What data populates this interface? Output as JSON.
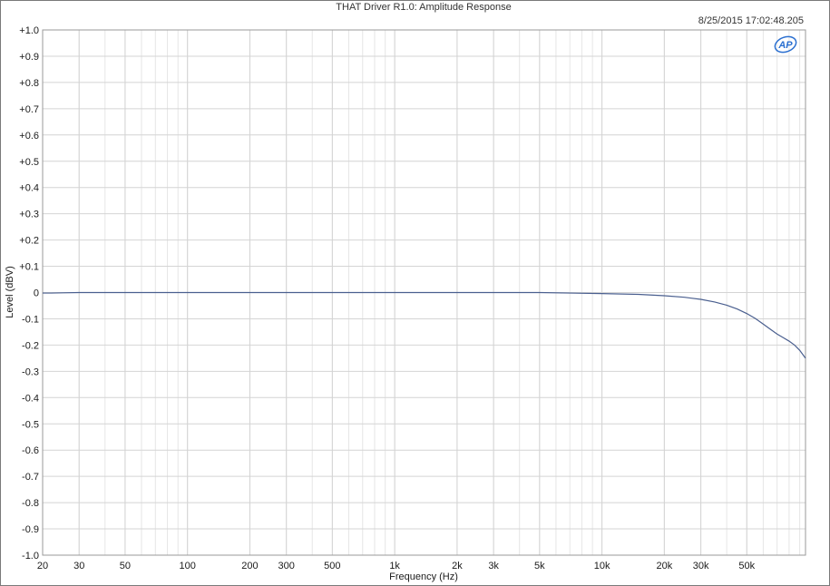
{
  "chart_data": {
    "type": "line",
    "title": "THAT Driver R1.0: Amplitude Response",
    "timestamp": "8/25/2015 17:02:48.205",
    "logo_text": "AP",
    "xlabel": "Frequency (Hz)",
    "ylabel": "Level (dBV)",
    "x_scale": "log",
    "xlim": [
      20,
      96000
    ],
    "ylim": [
      -1.0,
      1.0
    ],
    "grid": true,
    "x_ticks": [
      {
        "value": 20,
        "label": "20"
      },
      {
        "value": 30,
        "label": "30"
      },
      {
        "value": 50,
        "label": "50"
      },
      {
        "value": 100,
        "label": "100"
      },
      {
        "value": 200,
        "label": "200"
      },
      {
        "value": 300,
        "label": "300"
      },
      {
        "value": 500,
        "label": "500"
      },
      {
        "value": 1000,
        "label": "1k"
      },
      {
        "value": 2000,
        "label": "2k"
      },
      {
        "value": 3000,
        "label": "3k"
      },
      {
        "value": 5000,
        "label": "5k"
      },
      {
        "value": 10000,
        "label": "10k"
      },
      {
        "value": 20000,
        "label": "20k"
      },
      {
        "value": 30000,
        "label": "30k"
      },
      {
        "value": 50000,
        "label": "50k"
      }
    ],
    "y_ticks": [
      {
        "value": 1.0,
        "label": "+1.0"
      },
      {
        "value": 0.9,
        "label": "+0.9"
      },
      {
        "value": 0.8,
        "label": "+0.8"
      },
      {
        "value": 0.7,
        "label": "+0.7"
      },
      {
        "value": 0.6,
        "label": "+0.6"
      },
      {
        "value": 0.5,
        "label": "+0.5"
      },
      {
        "value": 0.4,
        "label": "+0.4"
      },
      {
        "value": 0.3,
        "label": "+0.3"
      },
      {
        "value": 0.2,
        "label": "+0.2"
      },
      {
        "value": 0.1,
        "label": "+0.1"
      },
      {
        "value": 0,
        "label": "0"
      },
      {
        "value": -0.1,
        "label": "-0.1"
      },
      {
        "value": -0.2,
        "label": "-0.2"
      },
      {
        "value": -0.3,
        "label": "-0.3"
      },
      {
        "value": -0.4,
        "label": "-0.4"
      },
      {
        "value": -0.5,
        "label": "-0.5"
      },
      {
        "value": -0.6,
        "label": "-0.6"
      },
      {
        "value": -0.7,
        "label": "-0.7"
      },
      {
        "value": -0.8,
        "label": "-0.8"
      },
      {
        "value": -0.9,
        "label": "-0.9"
      },
      {
        "value": -1.0,
        "label": "-1.0"
      }
    ],
    "series": [
      {
        "color": "#4a5f8f",
        "x": [
          20,
          22,
          25,
          30,
          50,
          100,
          1000,
          5000,
          7000,
          10000,
          15000,
          20000,
          25000,
          30000,
          35000,
          40000,
          45000,
          50000,
          55000,
          60000,
          65000,
          70000,
          75000,
          80000,
          85000,
          90000,
          96000
        ],
        "y": [
          -0.002,
          -0.002,
          -0.001,
          0,
          0,
          0,
          0,
          0,
          -0.002,
          -0.004,
          -0.007,
          -0.012,
          -0.018,
          -0.026,
          -0.036,
          -0.048,
          -0.063,
          -0.08,
          -0.099,
          -0.12,
          -0.14,
          -0.158,
          -0.172,
          -0.185,
          -0.2,
          -0.22,
          -0.25
        ]
      }
    ]
  }
}
